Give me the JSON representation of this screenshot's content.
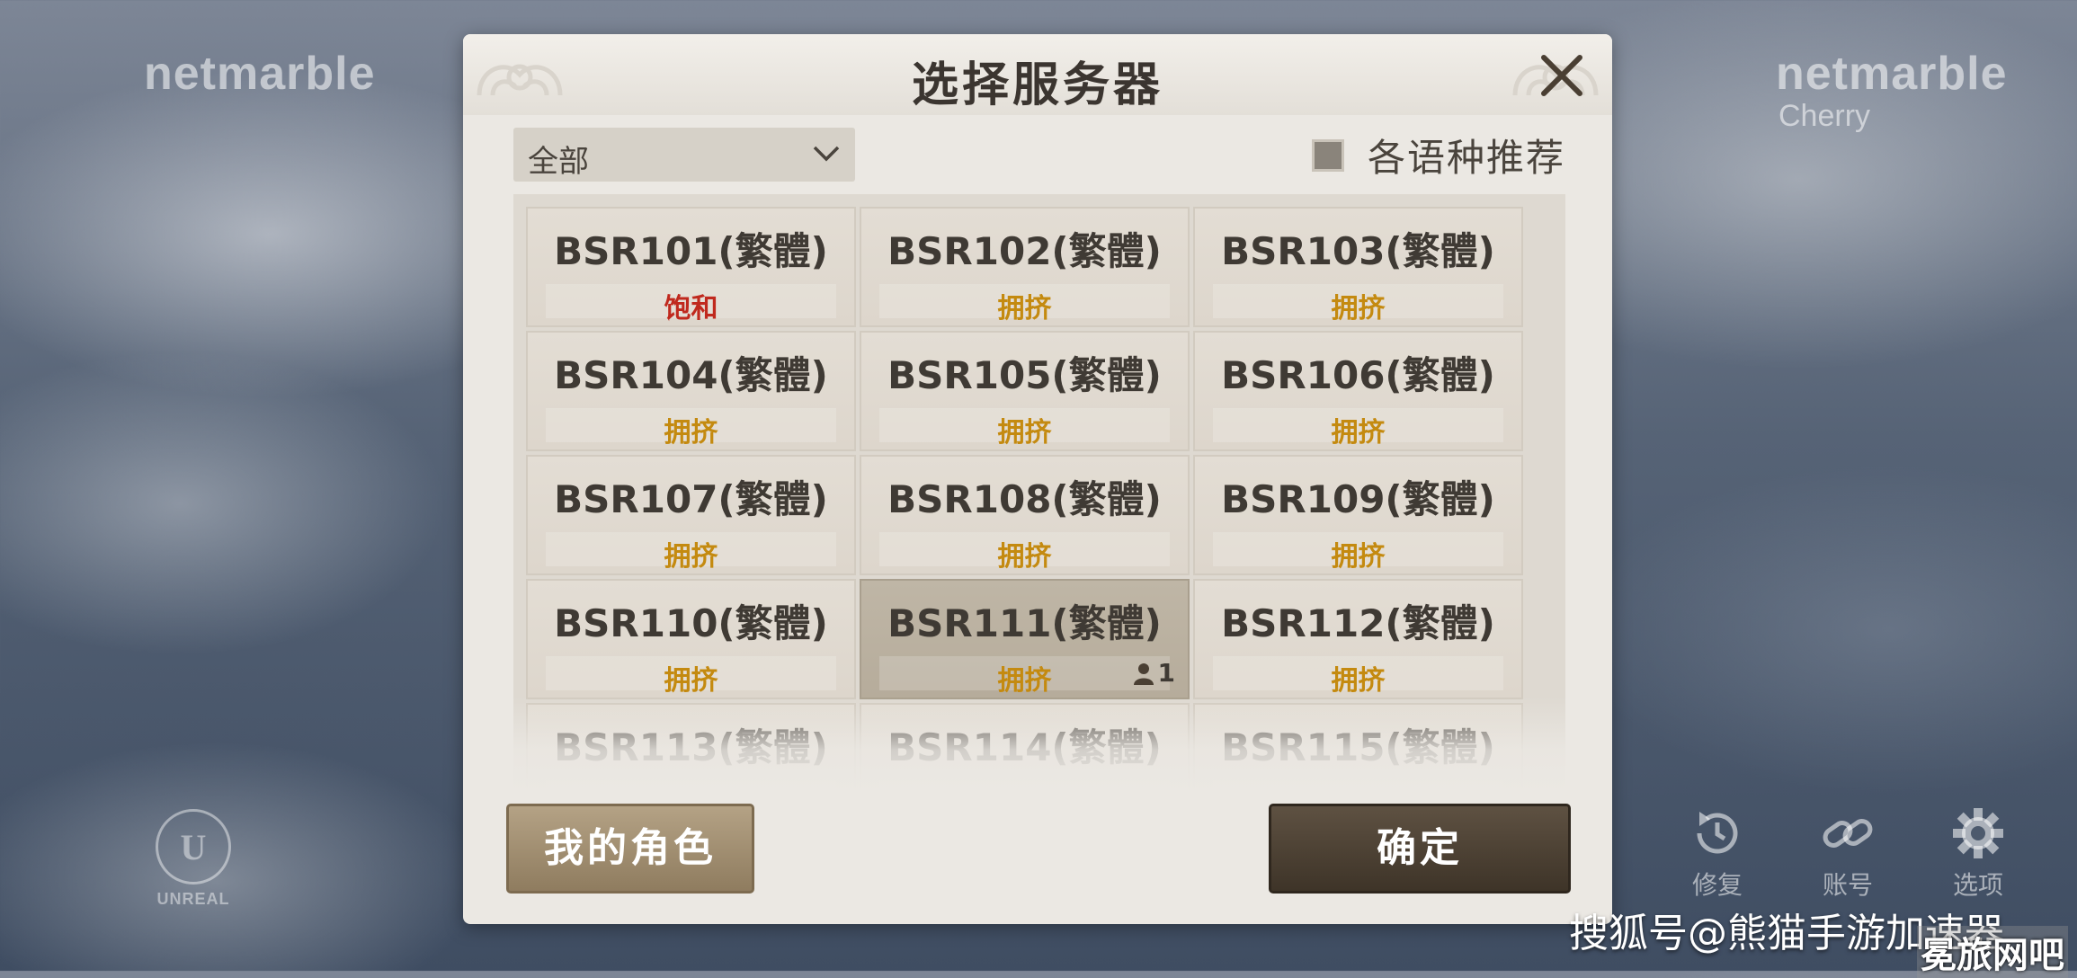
{
  "background": {
    "brand_left": "netmarble",
    "brand_right": "netmarble",
    "brand_right_sub": "Cherry",
    "engine_logo": "UNREAL"
  },
  "side_tools": [
    {
      "label": "修复",
      "icon": "repair-icon"
    },
    {
      "label": "账号",
      "icon": "link-icon"
    },
    {
      "label": "选项",
      "icon": "gear-icon"
    }
  ],
  "dialog": {
    "title": "选择服务器",
    "filter_value": "全部",
    "recommend_label": "各语种推荐",
    "recommend_checked": false
  },
  "colors": {
    "status_full": "#c0291e",
    "status_busy": "#c48a10"
  },
  "servers": [
    {
      "name": "BSR101(繁體)",
      "status": "饱和"
    },
    {
      "name": "BSR102(繁體)",
      "status": "拥挤"
    },
    {
      "name": "BSR103(繁體)",
      "status": "拥挤"
    },
    {
      "name": "BSR104(繁體)",
      "status": "拥挤"
    },
    {
      "name": "BSR105(繁體)",
      "status": "拥挤"
    },
    {
      "name": "BSR106(繁體)",
      "status": "拥挤"
    },
    {
      "name": "BSR107(繁體)",
      "status": "拥挤"
    },
    {
      "name": "BSR108(繁體)",
      "status": "拥挤"
    },
    {
      "name": "BSR109(繁體)",
      "status": "拥挤"
    },
    {
      "name": "BSR110(繁體)",
      "status": "拥挤"
    },
    {
      "name": "BSR111(繁體)",
      "status": "拥挤",
      "characters": "1",
      "selected": true
    },
    {
      "name": "BSR112(繁體)",
      "status": "拥挤"
    },
    {
      "name": "BSR113(繁體)",
      "status": ""
    },
    {
      "name": "BSR114(繁體)",
      "status": ""
    },
    {
      "name": "BSR115(繁體)",
      "status": ""
    }
  ],
  "buttons": {
    "my_characters": "我的角色",
    "confirm": "确定"
  },
  "watermark": {
    "text": "搜狐号@熊猫手游加速器",
    "corner": "冕旅网吧"
  }
}
